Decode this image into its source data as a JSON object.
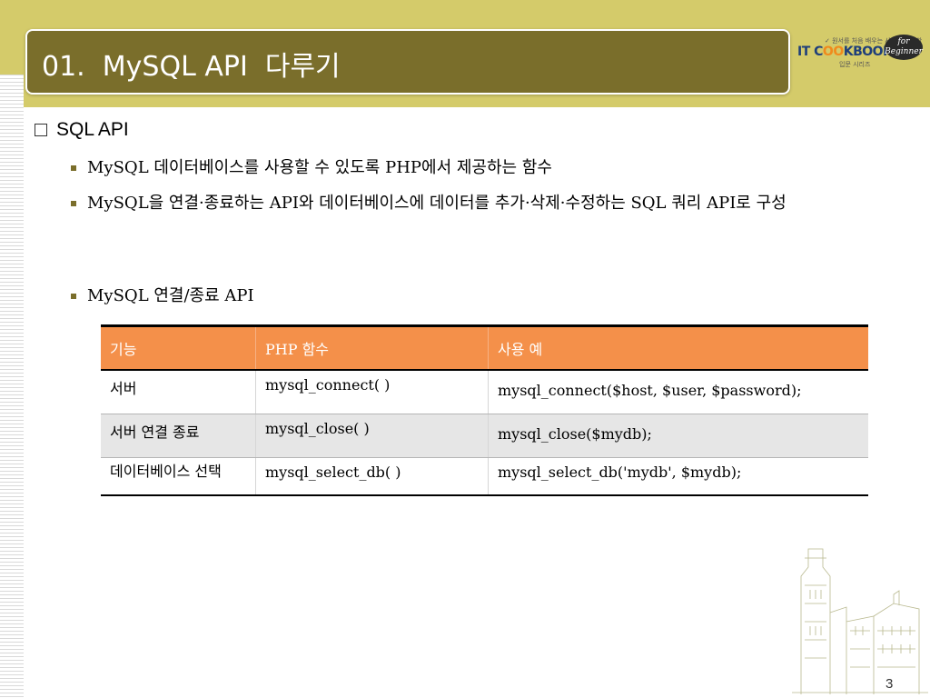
{
  "slide": {
    "title": "01.  MySQL API  다루기",
    "page_number": "3"
  },
  "logo": {
    "line1": "✓ 원서를 처음 배우는 사람들을 위한",
    "main_prefix": "IT C",
    "main_highlight": "OO",
    "main_suffix": "KBOOK",
    "line2": "입문 시리즈",
    "badge": "for Beginner"
  },
  "content": {
    "heading": "SQL API",
    "bullets": [
      "MySQL 데이터베이스를 사용할 수 있도록 PHP에서 제공하는 함수",
      "MySQL을 연결·종료하는 API와 데이터베이스에 데이터를 추가·삭제·수정하는 SQL 쿼리 API로 구성",
      "MySQL 연결/종료 API"
    ]
  },
  "table": {
    "headers": [
      "기능",
      "PHP 함수",
      "사용 예"
    ],
    "rows": [
      [
        "서버",
        "mysql_connect( )",
        "mysql_connect($host, $user, $password);"
      ],
      [
        "서버 연결 종료",
        "mysql_close( )",
        "mysql_close($mydb);"
      ],
      [
        "데이터베이스 선택",
        "mysql_select_db( )",
        "mysql_select_db('mydb', $mydb);"
      ]
    ]
  },
  "colors": {
    "title_bar": "#7a6e2b",
    "top_band": "#d4cb6a",
    "table_header": "#f4904a",
    "logo_badge": "#2a2a2a"
  },
  "icons": {
    "heading_marker": "checkbox-icon",
    "bullet_marker": "square-bullet-icon",
    "decoration": "building-sketch-icon"
  }
}
